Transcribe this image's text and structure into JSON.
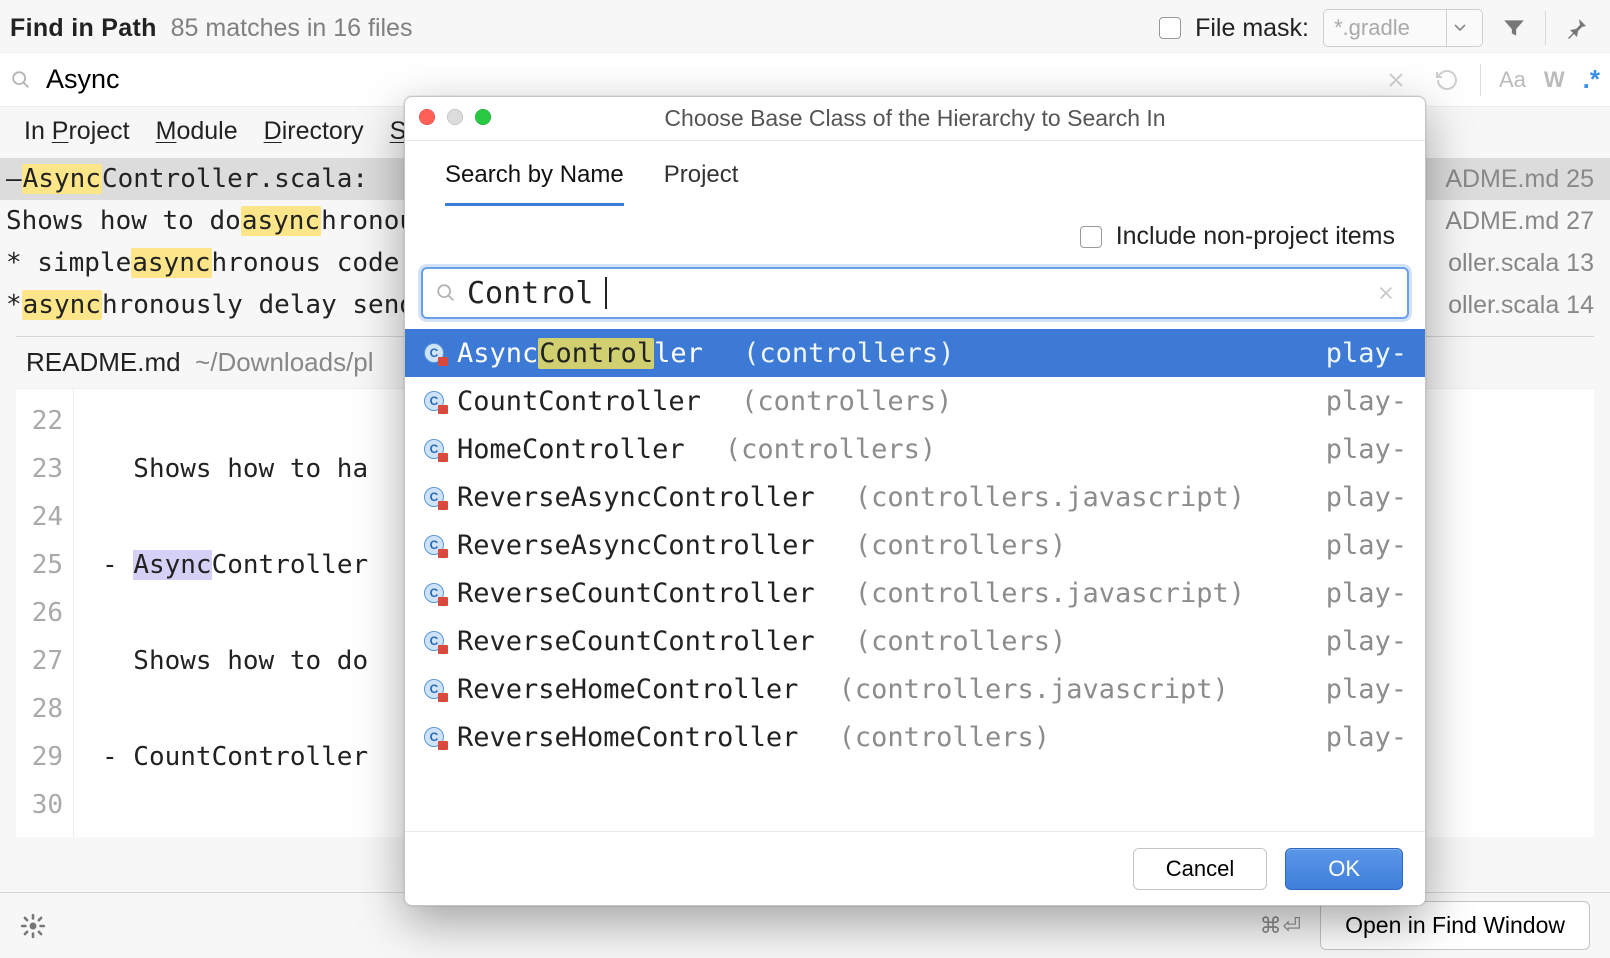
{
  "header": {
    "title": "Find in Path",
    "stats": "85 matches in 16 files",
    "file_mask_label": "File mask:",
    "file_mask_value": "*.gradle"
  },
  "search": {
    "value": "Async",
    "match_case_label": "Aa",
    "word_label": "W",
    "regex_label": ".*"
  },
  "scope": {
    "tabs": [
      "In Project",
      "Module",
      "Directory",
      "Scope"
    ],
    "accel_idx": [
      3,
      0,
      0,
      0
    ]
  },
  "results": [
    {
      "pre": "– ",
      "hl": "Async",
      "post": "Controller.scala:",
      "file": "ADME.md",
      "line": "25",
      "selected": true
    },
    {
      "pre": "Shows how to do ",
      "hl": "async",
      "post": "hronou",
      "file": "ADME.md",
      "line": "27",
      "selected": false
    },
    {
      "pre": "* simple ",
      "hl": "async",
      "post": "hronous code in",
      "file": "oller.scala",
      "line": "13",
      "selected": false
    },
    {
      "pre": "* ",
      "hl": "async",
      "post": "hronously delay sendin",
      "file": "oller.scala",
      "line": "14",
      "selected": false
    }
  ],
  "preview": {
    "file": "README.md",
    "path": "~/Downloads/pl",
    "gutter": [
      "22",
      "23",
      "24",
      "25",
      "26",
      "27",
      "28",
      "29",
      "30"
    ],
    "lines": [
      "",
      "  Shows how to ha",
      "",
      "- AsyncController",
      "",
      "  Shows how to do",
      "",
      "- CountController",
      ""
    ],
    "hl_line_index": 3,
    "hl_text": "Async"
  },
  "footer": {
    "kbd_hint": "⌘⏎",
    "open_label": "Open in Find Window"
  },
  "modal": {
    "title": "Choose Base Class of the Hierarchy to Search In",
    "tabs": [
      "Search by Name",
      "Project"
    ],
    "active_tab": 0,
    "include_label": "Include non-project items",
    "search_value": "Control",
    "items": [
      {
        "name": "AsyncController",
        "pkg": "(controllers)",
        "src": "play-",
        "selected": true,
        "match_start": 5,
        "match_len": 7
      },
      {
        "name": "CountController",
        "pkg": "(controllers)",
        "src": "play-",
        "selected": false
      },
      {
        "name": "HomeController",
        "pkg": "(controllers)",
        "src": "play-",
        "selected": false
      },
      {
        "name": "ReverseAsyncController",
        "pkg": "(controllers.javascript)",
        "src": "play-",
        "selected": false
      },
      {
        "name": "ReverseAsyncController",
        "pkg": "(controllers)",
        "src": "play-",
        "selected": false
      },
      {
        "name": "ReverseCountController",
        "pkg": "(controllers.javascript)",
        "src": "play-",
        "selected": false
      },
      {
        "name": "ReverseCountController",
        "pkg": "(controllers)",
        "src": "play-",
        "selected": false
      },
      {
        "name": "ReverseHomeController",
        "pkg": "(controllers.javascript)",
        "src": "play-",
        "selected": false
      },
      {
        "name": "ReverseHomeController",
        "pkg": "(controllers)",
        "src": "play-",
        "selected": false
      }
    ],
    "cancel_label": "Cancel",
    "ok_label": "OK"
  }
}
